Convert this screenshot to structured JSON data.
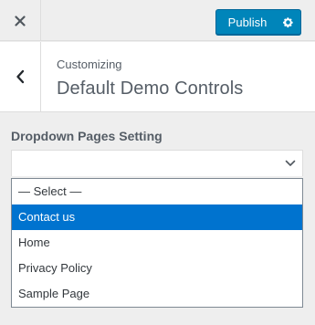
{
  "topbar": {
    "close_icon": "close-icon",
    "publish_label": "Publish",
    "settings_icon": "gear-icon",
    "publish_color": "#0085ba"
  },
  "header": {
    "back_icon": "chevron-left-icon",
    "breadcrumb": "Customizing",
    "title": "Default Demo Controls"
  },
  "control": {
    "label": "Dropdown Pages Setting",
    "dropdown_icon": "chevron-down-icon",
    "options": [
      "— Select —",
      "Contact us",
      "Home",
      "Privacy Policy",
      "Sample Page"
    ],
    "highlighted_option": "Contact us",
    "highlight_color": "#0073cf"
  }
}
